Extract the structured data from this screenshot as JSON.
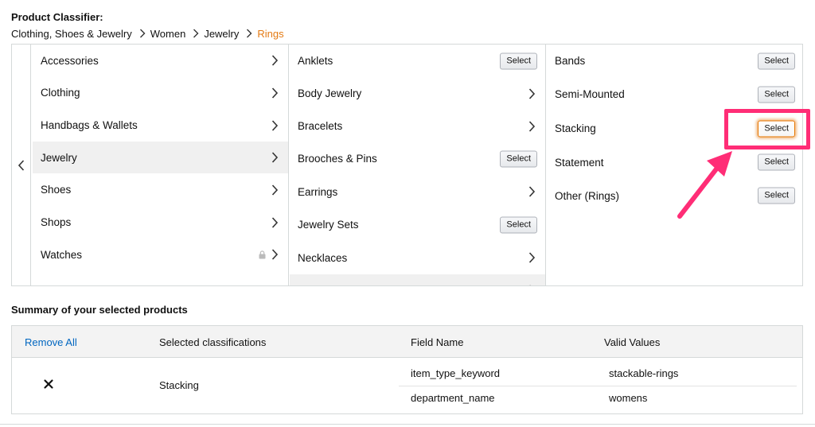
{
  "header": {
    "title": "Product Classifier:",
    "breadcrumb": [
      "Clothing, Shoes & Jewelry",
      "Women",
      "Jewelry"
    ],
    "breadcrumb_current": "Rings"
  },
  "columns": {
    "col1": [
      "Accessories",
      "Clothing",
      "Handbags & Wallets",
      "Jewelry",
      "Shoes",
      "Shops",
      "Watches"
    ],
    "col1_active": "Jewelry",
    "col2": [
      "Anklets",
      "Body Jewelry",
      "Bracelets",
      "Brooches & Pins",
      "Earrings",
      "Jewelry Sets",
      "Necklaces"
    ],
    "col3": [
      "Bands",
      "Semi-Mounted",
      "Stacking",
      "Statement",
      "Other (Rings)"
    ],
    "select_label": "Select"
  },
  "summary": {
    "title": "Summary of your selected products",
    "remove_all": "Remove All",
    "headers": {
      "classifications": "Selected classifications",
      "field_name": "Field Name",
      "valid_values": "Valid Values"
    },
    "row": {
      "classification": "Stacking",
      "fields": [
        {
          "name": "item_type_keyword",
          "value": "stackable-rings"
        },
        {
          "name": "department_name",
          "value": "womens"
        }
      ]
    }
  },
  "colors": {
    "accent_orange": "#e47911",
    "link_blue": "#0066c0",
    "highlight_pink": "#ff2d76"
  }
}
